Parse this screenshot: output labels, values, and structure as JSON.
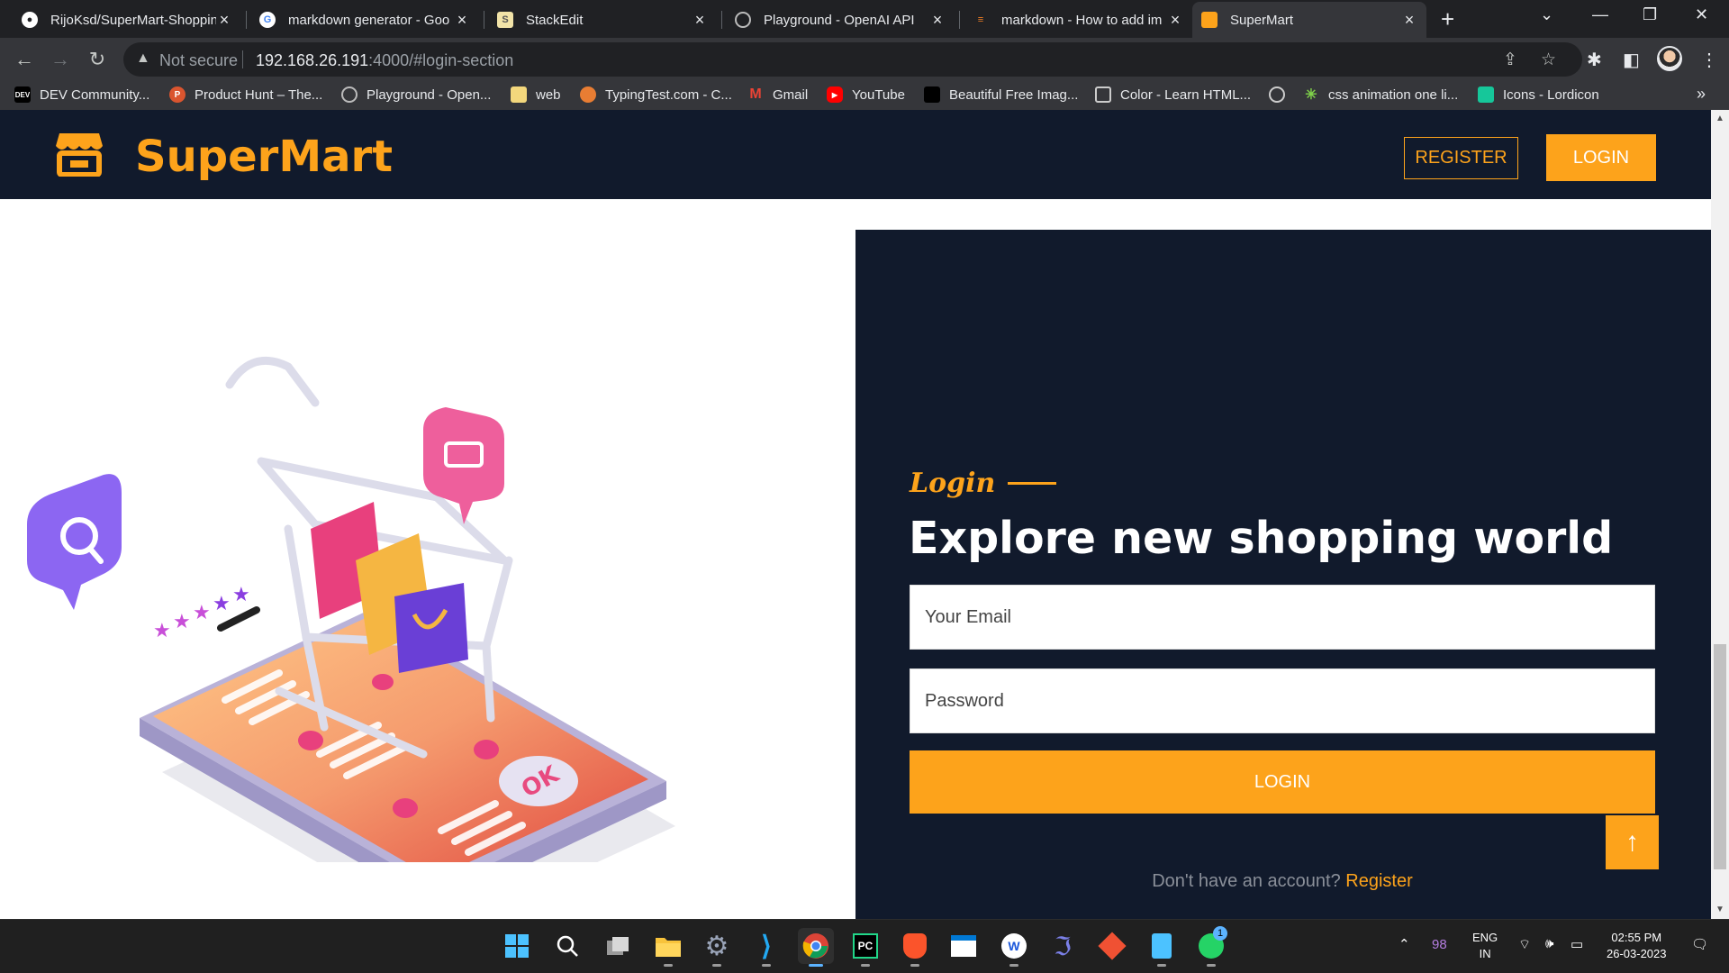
{
  "browser": {
    "tabs": [
      {
        "title": "RijoKsd/SuperMart-Shoppin",
        "icon": "github-icon"
      },
      {
        "title": "markdown generator - Goo",
        "icon": "google-icon"
      },
      {
        "title": "StackEdit",
        "icon": "stackedit-icon"
      },
      {
        "title": "Playground - OpenAI API",
        "icon": "openai-icon"
      },
      {
        "title": "markdown - How to add im",
        "icon": "stackoverflow-icon"
      },
      {
        "title": "SuperMart",
        "icon": "supermart-icon",
        "active": true
      }
    ],
    "address": {
      "security_label": "Not secure",
      "host": "192.168.26.191",
      "path": ":4000/#login-section"
    },
    "bookmarks": [
      {
        "label": "DEV Community...",
        "icon": "dev-icon"
      },
      {
        "label": "Product Hunt – The...",
        "icon": "producthunt-icon"
      },
      {
        "label": "Playground - Open...",
        "icon": "openai-icon"
      },
      {
        "label": "web",
        "icon": "folder-icon"
      },
      {
        "label": "TypingTest.com - C...",
        "icon": "typingtest-icon"
      },
      {
        "label": "Gmail",
        "icon": "gmail-icon"
      },
      {
        "label": "YouTube",
        "icon": "youtube-icon"
      },
      {
        "label": "Beautiful Free Imag...",
        "icon": "unsplash-icon"
      },
      {
        "label": "Color - Learn HTML...",
        "icon": "color-icon"
      },
      {
        "label": "",
        "icon": "globe-icon"
      },
      {
        "label": "css animation one li...",
        "icon": "css-icon"
      },
      {
        "label": "Icons - Lordicon",
        "icon": "lordicon-icon"
      }
    ]
  },
  "site": {
    "brand": "SuperMart",
    "nav": {
      "register_label": "REGISTER",
      "login_label": "LOGIN"
    },
    "login": {
      "tag": "Login",
      "heading": "Explore new shopping world",
      "email_placeholder": "Your Email",
      "password_placeholder": "Password",
      "submit_label": "LOGIN",
      "signup_prompt": "Don't have an account?",
      "signup_link": "Register"
    },
    "scroll_top_icon": "arrow-up-icon",
    "colors": {
      "accent": "#fda31b",
      "navy": "#111a2c"
    }
  },
  "taskbar": {
    "tray": {
      "battery_count": "98",
      "lang_line1": "ENG",
      "lang_line2": "IN",
      "time": "02:55 PM",
      "date": "26-03-2023",
      "whatsapp_badge": "1"
    }
  }
}
